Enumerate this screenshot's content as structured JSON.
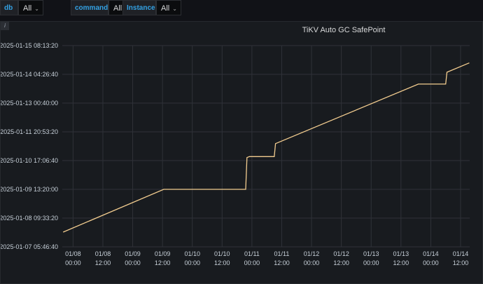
{
  "variables": [
    {
      "label": "db",
      "value": "All"
    },
    {
      "label": "command",
      "value": "All"
    },
    {
      "label": "Instance",
      "value": "All"
    }
  ],
  "panel": {
    "info_icon": "i",
    "title": "TiKV Auto GC SafePoint"
  },
  "chart_data": {
    "type": "line",
    "title": "TiKV Auto GC SafePoint",
    "xlabel": "",
    "ylabel": "",
    "x_ticks": [
      {
        "date": "01/08",
        "time": "00:00",
        "value": "2025-01-08T00:00"
      },
      {
        "date": "01/08",
        "time": "12:00",
        "value": "2025-01-08T12:00"
      },
      {
        "date": "01/09",
        "time": "00:00",
        "value": "2025-01-09T00:00"
      },
      {
        "date": "01/09",
        "time": "12:00",
        "value": "2025-01-09T12:00"
      },
      {
        "date": "01/10",
        "time": "00:00",
        "value": "2025-01-10T00:00"
      },
      {
        "date": "01/10",
        "time": "12:00",
        "value": "2025-01-10T12:00"
      },
      {
        "date": "01/11",
        "time": "00:00",
        "value": "2025-01-11T00:00"
      },
      {
        "date": "01/11",
        "time": "12:00",
        "value": "2025-01-11T12:00"
      },
      {
        "date": "01/12",
        "time": "00:00",
        "value": "2025-01-12T00:00"
      },
      {
        "date": "01/12",
        "time": "12:00",
        "value": "2025-01-12T12:00"
      },
      {
        "date": "01/13",
        "time": "00:00",
        "value": "2025-01-13T00:00"
      },
      {
        "date": "01/13",
        "time": "12:00",
        "value": "2025-01-13T12:00"
      },
      {
        "date": "01/14",
        "time": "00:00",
        "value": "2025-01-14T00:00"
      },
      {
        "date": "01/14",
        "time": "12:00",
        "value": "2025-01-14T12:00"
      }
    ],
    "xlim": [
      "2025-01-07T19:40",
      "2025-01-14T15:40"
    ],
    "y_ticks": [
      {
        "label": "2025-01-07 05:46:40",
        "value": "2025-01-07T05:46:40"
      },
      {
        "label": "2025-01-08 09:33:20",
        "value": "2025-01-08T09:33:20"
      },
      {
        "label": "2025-01-09 13:20:00",
        "value": "2025-01-09T13:20:00"
      },
      {
        "label": "2025-01-10 17:06:40",
        "value": "2025-01-10T17:06:40"
      },
      {
        "label": "2025-01-11 20:53:20",
        "value": "2025-01-11T20:53:20"
      },
      {
        "label": "2025-01-13 00:40:00",
        "value": "2025-01-13T00:40:00"
      },
      {
        "label": "2025-01-14 04:26:40",
        "value": "2025-01-14T04:26:40"
      },
      {
        "label": "2025-01-15 08:13:20",
        "value": "2025-01-15T08:13:20"
      }
    ],
    "ylim": [
      "2025-01-07T05:46:40",
      "2025-01-15T08:13:20"
    ],
    "grid": true,
    "series": [
      {
        "color": "#f2cc8f",
        "points": [
          {
            "x": "2025-01-07T20:00",
            "y": "2025-01-07T20:00"
          },
          {
            "x": "2025-01-09T12:30",
            "y": "2025-01-09T13:20"
          },
          {
            "x": "2025-01-10T21:30",
            "y": "2025-01-09T13:20"
          },
          {
            "x": "2025-01-10T22:00",
            "y": "2025-01-10T20:00"
          },
          {
            "x": "2025-01-10T23:00",
            "y": "2025-01-10T21:00"
          },
          {
            "x": "2025-01-11T09:00",
            "y": "2025-01-10T21:00"
          },
          {
            "x": "2025-01-11T09:30",
            "y": "2025-01-11T09:30"
          },
          {
            "x": "2025-01-13T19:00",
            "y": "2025-01-13T19:00"
          },
          {
            "x": "2025-01-14T06:00",
            "y": "2025-01-13T19:00"
          },
          {
            "x": "2025-01-14T06:30",
            "y": "2025-01-14T06:30"
          },
          {
            "x": "2025-01-14T15:30",
            "y": "2025-01-14T15:30"
          }
        ]
      }
    ]
  }
}
